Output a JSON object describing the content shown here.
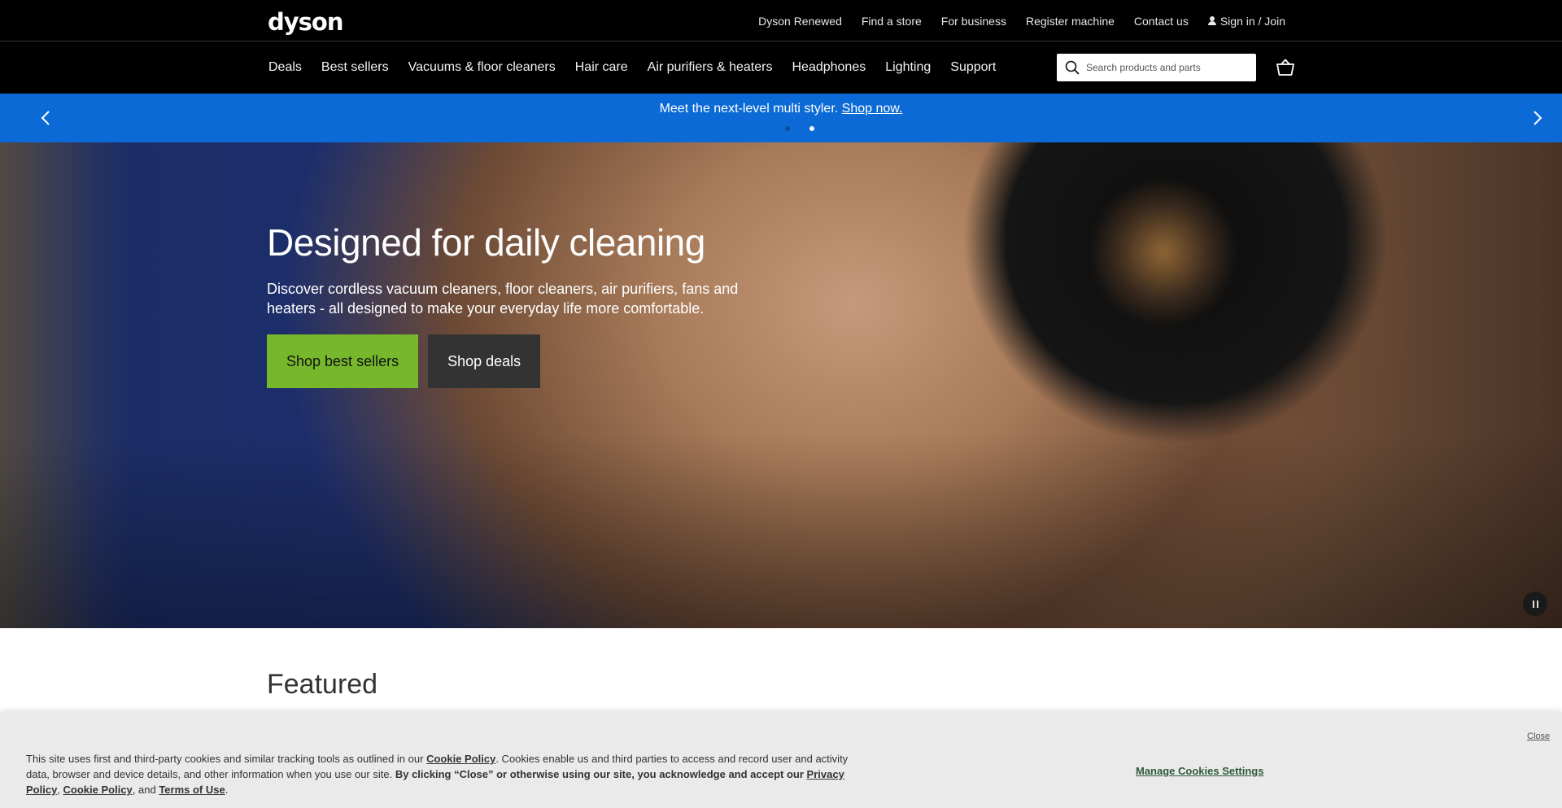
{
  "header": {
    "logo": "dyson",
    "utility_links": [
      "Dyson Renewed",
      "Find a store",
      "For business",
      "Register machine",
      "Contact us"
    ],
    "sign_in": "Sign in / Join"
  },
  "nav": {
    "items": [
      "Deals",
      "Best sellers",
      "Vacuums & floor cleaners",
      "Hair care",
      "Air purifiers & heaters",
      "Headphones",
      "Lighting",
      "Support"
    ],
    "search_placeholder": "Search products and parts"
  },
  "promo": {
    "text": "Meet the next-level multi styler.",
    "link": "Shop now.",
    "slide_count": 2,
    "active_slide": 2
  },
  "hero": {
    "title": "Designed for daily cleaning",
    "description": "Discover cordless vacuum cleaners, floor cleaners, air purifiers, fans and heaters - all designed to make your everyday life more comfortable.",
    "primary_button": "Shop best sellers",
    "secondary_button": "Shop deals"
  },
  "featured": {
    "title": "Featured"
  },
  "cookie": {
    "text_1": "This site uses first and third-party cookies and similar tracking tools as outlined in our",
    "link_cookie_policy": "Cookie Policy",
    "text_2": ". Cookies enable us and third parties to access and record user and activity data, browser and device details, and other information when you use our site.",
    "text_bold": "By clicking “Close” or otherwise using our site, you acknowledge and accept our",
    "link_privacy_policy": "Privacy Policy",
    "link_cookie_policy_2": "Cookie Policy",
    "text_and": ", and",
    "link_terms": "Terms of Use",
    "manage": "Manage Cookies Settings",
    "close": "Close"
  },
  "colors": {
    "promo_blue": "#0c6ad6",
    "primary_green": "#77b72b",
    "header_black": "#000000"
  }
}
